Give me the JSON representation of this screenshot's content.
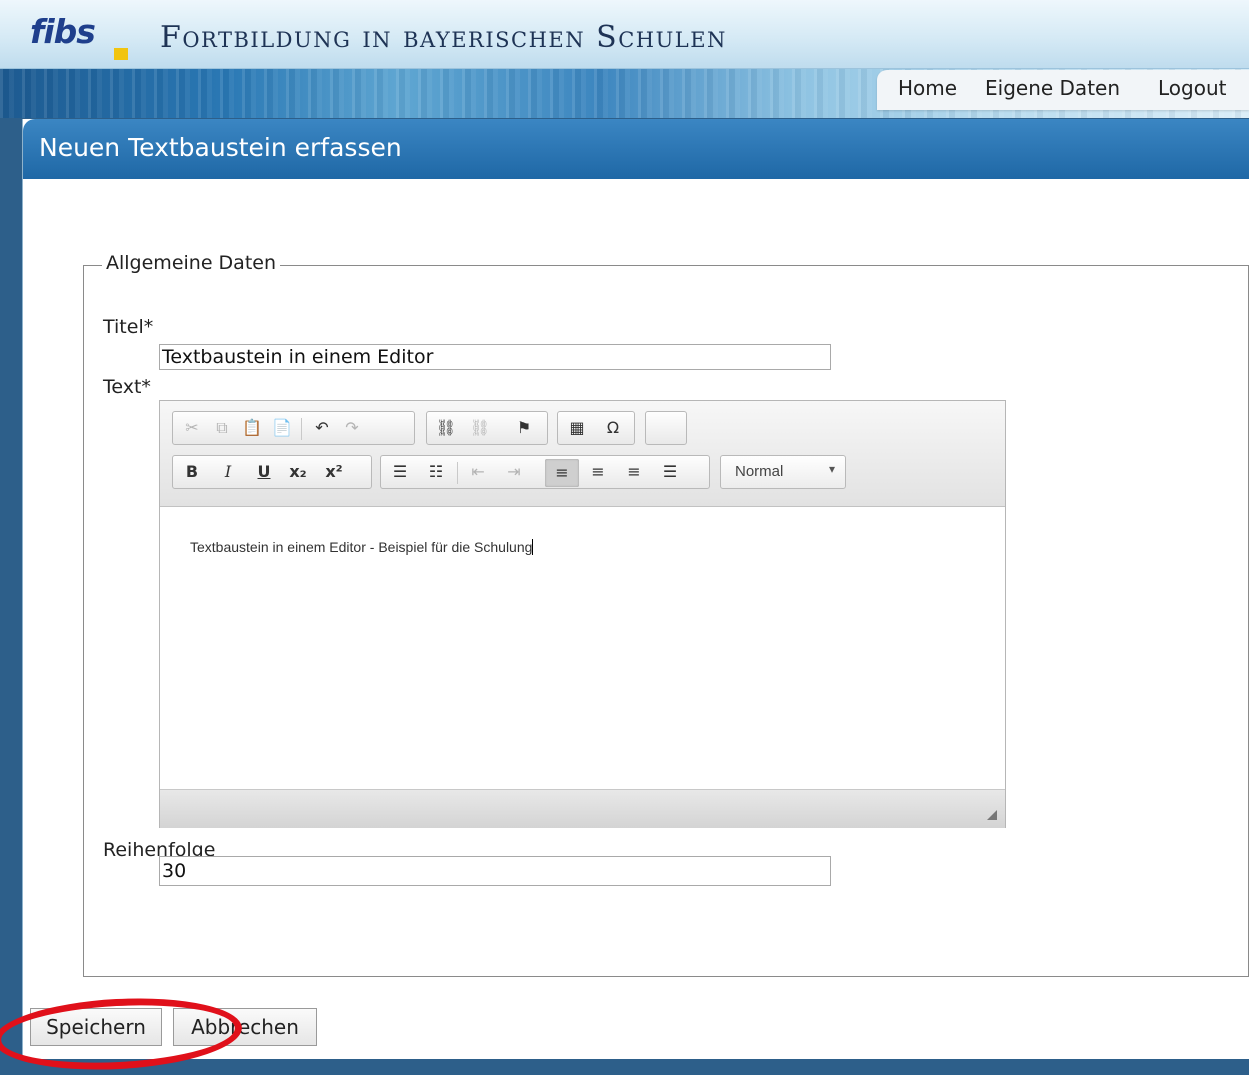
{
  "header": {
    "logo_text": "fibs",
    "site_title": "Fortbildung in bayerischen Schulen",
    "nav": [
      "Home",
      "Eigene Daten",
      "Logout"
    ]
  },
  "page": {
    "title": "Neuen Textbaustein erfassen"
  },
  "form": {
    "legend": "Allgemeine Daten",
    "titel_label": "Titel*",
    "titel_value": "Textbaustein in einem Editor",
    "text_label": "Text*",
    "editor": {
      "format_value": "Normal",
      "content": "Textbaustein in einem Editor - Beispiel für die Schulung",
      "toolbar_icons": [
        "cut-icon",
        "copy-icon",
        "paste-icon",
        "paste-text-icon",
        "undo-icon",
        "redo-icon",
        "link-icon",
        "unlink-icon",
        "anchor-icon",
        "table-icon",
        "special-char-icon",
        "bold-icon",
        "italic-icon",
        "underline-icon",
        "subscript-icon",
        "superscript-icon",
        "numbered-list-icon",
        "bulleted-list-icon",
        "outdent-icon",
        "indent-icon",
        "align-left-icon",
        "align-center-icon",
        "align-right-icon",
        "justify-icon"
      ]
    },
    "reihenfolge_label": "Reihenfolge",
    "reihenfolge_value": "30"
  },
  "buttons": {
    "save": "Speichern",
    "cancel": "Abbrechen"
  },
  "colors": {
    "header_blue": "#1f68a6",
    "highlight_red": "#e0101a",
    "logo_blue": "#1f3f8c",
    "logo_yellow": "#f1c40f"
  }
}
